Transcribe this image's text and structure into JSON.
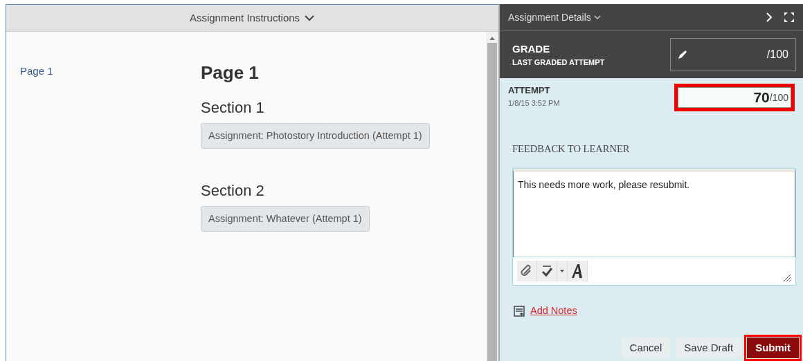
{
  "instructions": {
    "title": "Assignment Instructions",
    "toc": [
      {
        "label": "Page 1",
        "selected": false
      }
    ],
    "page_title": "Page 1",
    "sections": [
      {
        "title": "Section 1",
        "items": [
          {
            "label": "Assignment: Photostory Introduction (Attempt 1)"
          }
        ]
      },
      {
        "title": "Section 2",
        "items": [
          {
            "label": "Assignment: Whatever (Attempt 1)"
          }
        ]
      }
    ]
  },
  "details": {
    "title": "Assignment Details",
    "grade": {
      "label": "GRADE",
      "sublabel": "LAST GRADED ATTEMPT",
      "max": "/100"
    },
    "attempt": {
      "label": "ATTEMPT",
      "date": "1/8/15 3:52 PM",
      "score": "70",
      "max": "/100",
      "highlighted": true
    },
    "feedback": {
      "label": "FEEDBACK TO LEARNER",
      "value": "This needs more work, please resubmit."
    },
    "add_notes": "Add Notes",
    "buttons": [
      {
        "label": "Cancel",
        "kind": "plain",
        "highlighted": false
      },
      {
        "label": "Save Draft",
        "kind": "plain",
        "highlighted": false
      },
      {
        "label": "Submit",
        "kind": "primary",
        "highlighted": true
      }
    ]
  }
}
